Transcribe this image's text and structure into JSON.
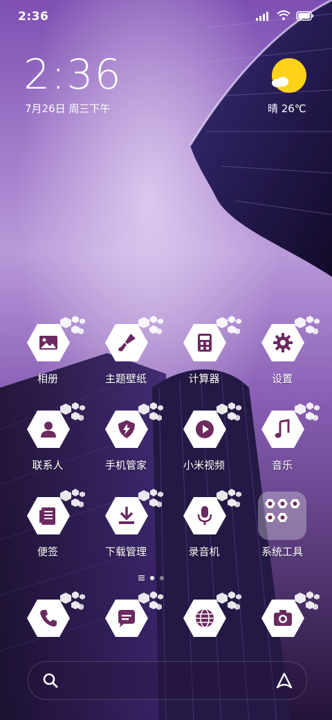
{
  "status_bar": {
    "time": "2:36",
    "icons": [
      "signal-icon",
      "wifi-icon",
      "battery-icon"
    ]
  },
  "clock_widget": {
    "time": "2:36",
    "date": "7月26日 周三下午"
  },
  "weather_widget": {
    "text": "晴 26℃",
    "icon": "sun-cloud-icon"
  },
  "apps": [
    {
      "label": "相册",
      "icon": "gallery-icon"
    },
    {
      "label": "主题壁纸",
      "icon": "paintbrush-icon"
    },
    {
      "label": "计算器",
      "icon": "calculator-icon"
    },
    {
      "label": "设置",
      "icon": "gear-icon"
    },
    {
      "label": "联系人",
      "icon": "contacts-icon"
    },
    {
      "label": "手机管家",
      "icon": "shield-icon"
    },
    {
      "label": "小米视频",
      "icon": "play-icon"
    },
    {
      "label": "音乐",
      "icon": "music-note-icon"
    },
    {
      "label": "便签",
      "icon": "notes-icon"
    },
    {
      "label": "下载管理",
      "icon": "download-icon"
    },
    {
      "label": "录音机",
      "icon": "microphone-icon"
    },
    {
      "label": "系统工具",
      "icon": "folder-icon"
    }
  ],
  "dock": [
    {
      "icon": "phone-icon"
    },
    {
      "icon": "message-icon"
    },
    {
      "icon": "browser-globe-icon"
    },
    {
      "icon": "camera-icon"
    }
  ],
  "page_indicator": {
    "pages": 2,
    "current": 1
  },
  "search_bar": {
    "left_icon": "search-icon",
    "right_icon": "assistant-icon"
  },
  "colors": {
    "icon_fg": "#6b2a60",
    "icon_bg": "#ffffff",
    "sun": "#ffd21a",
    "bg_top": "#b58ad9",
    "bg_bottom": "#1a1030"
  }
}
